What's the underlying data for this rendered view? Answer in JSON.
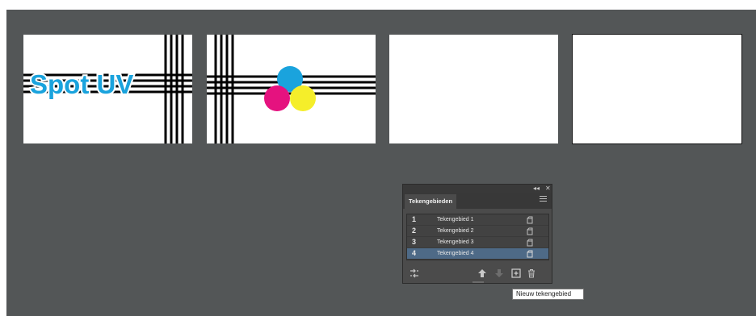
{
  "artboards": {
    "logo_text": "Spot UV"
  },
  "panel": {
    "collapse_label": "◂◂",
    "close_label": "✕",
    "tab_title": "Tekengebieden",
    "rows": [
      {
        "num": "1",
        "name": "Tekengebied 1",
        "selected": false
      },
      {
        "num": "2",
        "name": "Tekengebied 2",
        "selected": false
      },
      {
        "num": "3",
        "name": "Tekengebied 3",
        "selected": false
      },
      {
        "num": "4",
        "name": "Tekengebied 4",
        "selected": true
      }
    ],
    "bottom_icons": [
      "rearrange-icon",
      "move-up-icon",
      "move-down-icon",
      "new-artboard-icon",
      "delete-icon"
    ]
  },
  "tooltip": {
    "text": "Nieuw tekengebied"
  },
  "colors": {
    "canvas": "#535657",
    "cyan": "#1aa3dd",
    "magenta": "#e5127f",
    "yellow": "#f5ee2a",
    "selection": "#4e6a87"
  }
}
